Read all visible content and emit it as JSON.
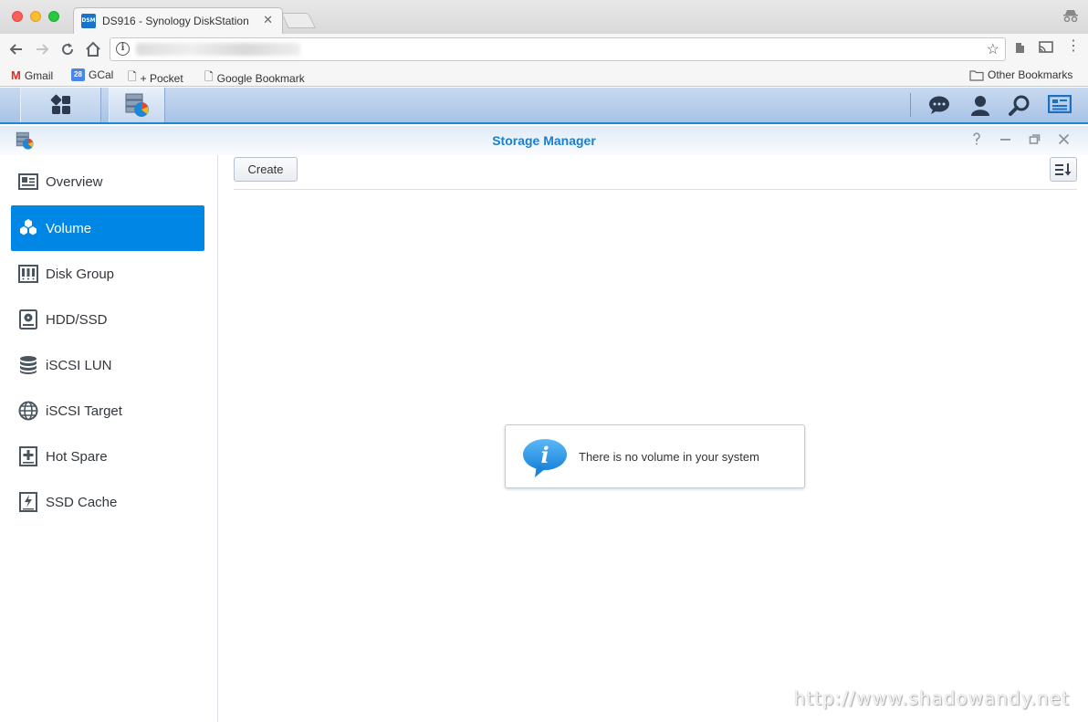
{
  "browser": {
    "tab_title": "DS916 - Synology DiskStation",
    "tab_favicon_text": "DSM",
    "tab_close": "✕",
    "bookmarks": [
      {
        "label": "Gmail",
        "icon": "gmail-icon"
      },
      {
        "label": "GCal",
        "icon": "gcal-icon",
        "badge": "28"
      },
      {
        "label": "+ Pocket",
        "icon": "page-icon"
      },
      {
        "label": "Google Bookmark",
        "icon": "page-icon"
      }
    ],
    "other_bookmarks": "Other Bookmarks"
  },
  "window": {
    "title": "Storage Manager",
    "controls": [
      "help",
      "minimize",
      "restore",
      "close"
    ]
  },
  "sidebar": {
    "items": [
      {
        "label": "Overview",
        "icon": "overview-icon",
        "active": false
      },
      {
        "label": "Volume",
        "icon": "volume-icon",
        "active": true
      },
      {
        "label": "Disk Group",
        "icon": "disk-group-icon",
        "active": false
      },
      {
        "label": "HDD/SSD",
        "icon": "hdd-icon",
        "active": false
      },
      {
        "label": "iSCSI LUN",
        "icon": "iscsi-lun-icon",
        "active": false
      },
      {
        "label": "iSCSI Target",
        "icon": "iscsi-target-icon",
        "active": false
      },
      {
        "label": "Hot Spare",
        "icon": "hot-spare-icon",
        "active": false
      },
      {
        "label": "SSD Cache",
        "icon": "ssd-cache-icon",
        "active": false
      }
    ]
  },
  "main": {
    "create_label": "Create",
    "empty_message": "There is no volume in your system"
  },
  "watermark": "http://www.shadowandy.net",
  "colors": {
    "accent": "#0086e5",
    "title_blue": "#1a7fcc"
  }
}
